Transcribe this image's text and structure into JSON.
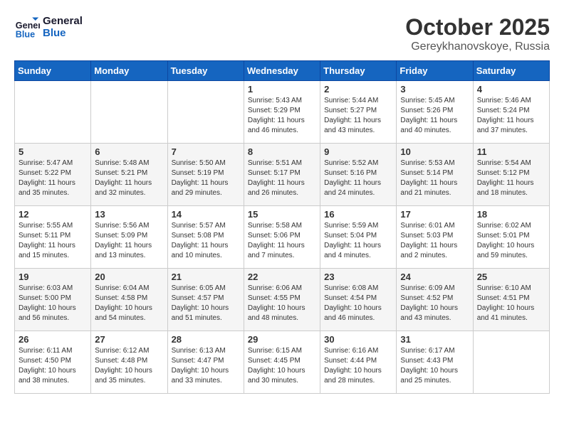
{
  "header": {
    "logo": {
      "line1": "General",
      "line2": "Blue"
    },
    "title": "October 2025",
    "location": "Gereykhanovskoye, Russia"
  },
  "weekdays": [
    "Sunday",
    "Monday",
    "Tuesday",
    "Wednesday",
    "Thursday",
    "Friday",
    "Saturday"
  ],
  "weeks": [
    [
      {
        "day": "",
        "info": ""
      },
      {
        "day": "",
        "info": ""
      },
      {
        "day": "",
        "info": ""
      },
      {
        "day": "1",
        "info": "Sunrise: 5:43 AM\nSunset: 5:29 PM\nDaylight: 11 hours\nand 46 minutes."
      },
      {
        "day": "2",
        "info": "Sunrise: 5:44 AM\nSunset: 5:27 PM\nDaylight: 11 hours\nand 43 minutes."
      },
      {
        "day": "3",
        "info": "Sunrise: 5:45 AM\nSunset: 5:26 PM\nDaylight: 11 hours\nand 40 minutes."
      },
      {
        "day": "4",
        "info": "Sunrise: 5:46 AM\nSunset: 5:24 PM\nDaylight: 11 hours\nand 37 minutes."
      }
    ],
    [
      {
        "day": "5",
        "info": "Sunrise: 5:47 AM\nSunset: 5:22 PM\nDaylight: 11 hours\nand 35 minutes."
      },
      {
        "day": "6",
        "info": "Sunrise: 5:48 AM\nSunset: 5:21 PM\nDaylight: 11 hours\nand 32 minutes."
      },
      {
        "day": "7",
        "info": "Sunrise: 5:50 AM\nSunset: 5:19 PM\nDaylight: 11 hours\nand 29 minutes."
      },
      {
        "day": "8",
        "info": "Sunrise: 5:51 AM\nSunset: 5:17 PM\nDaylight: 11 hours\nand 26 minutes."
      },
      {
        "day": "9",
        "info": "Sunrise: 5:52 AM\nSunset: 5:16 PM\nDaylight: 11 hours\nand 24 minutes."
      },
      {
        "day": "10",
        "info": "Sunrise: 5:53 AM\nSunset: 5:14 PM\nDaylight: 11 hours\nand 21 minutes."
      },
      {
        "day": "11",
        "info": "Sunrise: 5:54 AM\nSunset: 5:12 PM\nDaylight: 11 hours\nand 18 minutes."
      }
    ],
    [
      {
        "day": "12",
        "info": "Sunrise: 5:55 AM\nSunset: 5:11 PM\nDaylight: 11 hours\nand 15 minutes."
      },
      {
        "day": "13",
        "info": "Sunrise: 5:56 AM\nSunset: 5:09 PM\nDaylight: 11 hours\nand 13 minutes."
      },
      {
        "day": "14",
        "info": "Sunrise: 5:57 AM\nSunset: 5:08 PM\nDaylight: 11 hours\nand 10 minutes."
      },
      {
        "day": "15",
        "info": "Sunrise: 5:58 AM\nSunset: 5:06 PM\nDaylight: 11 hours\nand 7 minutes."
      },
      {
        "day": "16",
        "info": "Sunrise: 5:59 AM\nSunset: 5:04 PM\nDaylight: 11 hours\nand 4 minutes."
      },
      {
        "day": "17",
        "info": "Sunrise: 6:01 AM\nSunset: 5:03 PM\nDaylight: 11 hours\nand 2 minutes."
      },
      {
        "day": "18",
        "info": "Sunrise: 6:02 AM\nSunset: 5:01 PM\nDaylight: 10 hours\nand 59 minutes."
      }
    ],
    [
      {
        "day": "19",
        "info": "Sunrise: 6:03 AM\nSunset: 5:00 PM\nDaylight: 10 hours\nand 56 minutes."
      },
      {
        "day": "20",
        "info": "Sunrise: 6:04 AM\nSunset: 4:58 PM\nDaylight: 10 hours\nand 54 minutes."
      },
      {
        "day": "21",
        "info": "Sunrise: 6:05 AM\nSunset: 4:57 PM\nDaylight: 10 hours\nand 51 minutes."
      },
      {
        "day": "22",
        "info": "Sunrise: 6:06 AM\nSunset: 4:55 PM\nDaylight: 10 hours\nand 48 minutes."
      },
      {
        "day": "23",
        "info": "Sunrise: 6:08 AM\nSunset: 4:54 PM\nDaylight: 10 hours\nand 46 minutes."
      },
      {
        "day": "24",
        "info": "Sunrise: 6:09 AM\nSunset: 4:52 PM\nDaylight: 10 hours\nand 43 minutes."
      },
      {
        "day": "25",
        "info": "Sunrise: 6:10 AM\nSunset: 4:51 PM\nDaylight: 10 hours\nand 41 minutes."
      }
    ],
    [
      {
        "day": "26",
        "info": "Sunrise: 6:11 AM\nSunset: 4:50 PM\nDaylight: 10 hours\nand 38 minutes."
      },
      {
        "day": "27",
        "info": "Sunrise: 6:12 AM\nSunset: 4:48 PM\nDaylight: 10 hours\nand 35 minutes."
      },
      {
        "day": "28",
        "info": "Sunrise: 6:13 AM\nSunset: 4:47 PM\nDaylight: 10 hours\nand 33 minutes."
      },
      {
        "day": "29",
        "info": "Sunrise: 6:15 AM\nSunset: 4:45 PM\nDaylight: 10 hours\nand 30 minutes."
      },
      {
        "day": "30",
        "info": "Sunrise: 6:16 AM\nSunset: 4:44 PM\nDaylight: 10 hours\nand 28 minutes."
      },
      {
        "day": "31",
        "info": "Sunrise: 6:17 AM\nSunset: 4:43 PM\nDaylight: 10 hours\nand 25 minutes."
      },
      {
        "day": "",
        "info": ""
      }
    ]
  ]
}
